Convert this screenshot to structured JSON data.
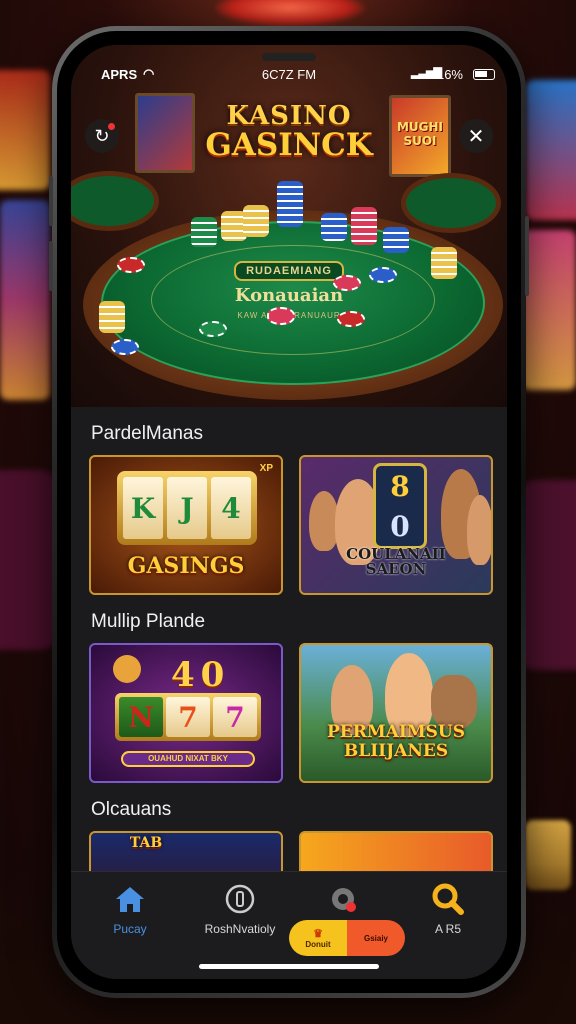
{
  "status_bar": {
    "carrier": "APRS",
    "time": "6C7Z FM",
    "battery": "16%"
  },
  "hero": {
    "logo_line1": "KASINO",
    "logo_line2": "GASINCK",
    "frame_left_label": "",
    "frame_right_label": "MUGHI SUOI",
    "felt_banner": "RUDAEMIANG",
    "felt_title": "Konauaian",
    "felt_subtitle": "KAW AUSAGRANUAUR",
    "close_icon": "close-icon",
    "refresh_icon": "refresh-icon"
  },
  "sections": [
    {
      "title": "PardelManas",
      "cards": [
        {
          "caption": "GASINGS",
          "reels": [
            "K",
            "J",
            "4"
          ],
          "badge": "XP"
        },
        {
          "caption": "COULANAII SAEON",
          "display": [
            "8",
            "0"
          ]
        }
      ]
    },
    {
      "title": "Mullip Plande",
      "cards": [
        {
          "caption": "OUAHUD NIXAT BKY",
          "reels_top": [
            "4",
            "0"
          ],
          "reels_bottom": [
            "N",
            "7",
            "7"
          ]
        },
        {
          "caption": "PERMAIMSUS BLIIJANES"
        }
      ]
    },
    {
      "title": "Olcauans",
      "cards": [
        {
          "caption": "TAB"
        },
        {
          "caption": ""
        }
      ]
    }
  ],
  "bottom_nav": {
    "items": [
      {
        "label": "Pucay",
        "icon": "home-icon"
      },
      {
        "label": "RoshNvatioly",
        "icon": "coin-icon"
      },
      {
        "label": "",
        "icon": "gear-icon"
      },
      {
        "label": "A R5",
        "icon": "search-icon"
      }
    ],
    "promo_left": "Donuit",
    "promo_right": "Gsiaiy"
  },
  "colors": {
    "accent_gold": "#ffcf3a",
    "active_nav": "#4a90e2",
    "screen_bg": "#1b1b1d"
  }
}
